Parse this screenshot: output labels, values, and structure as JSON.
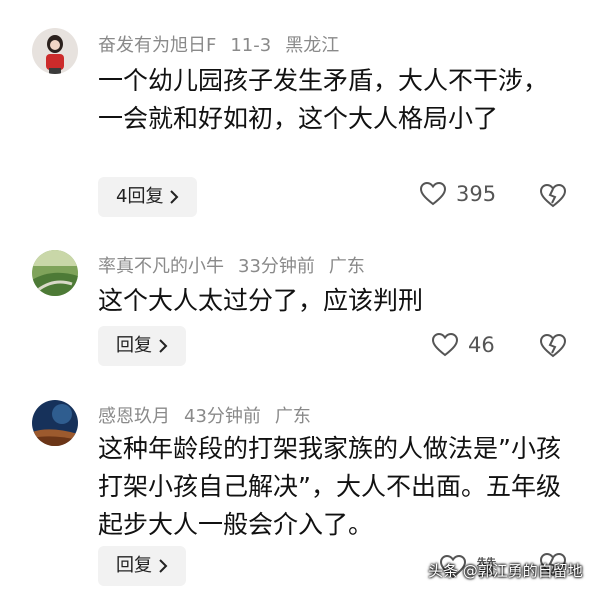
{
  "comments": [
    {
      "username": "奋发有为旭日F",
      "time": "11-3",
      "location": "黑龙江",
      "text": "一个幼儿园孩子发生矛盾，大人不干涉，一会就和好如初，这个大人格局小了",
      "reply_label": "4回复",
      "likes": "395"
    },
    {
      "username": "率真不凡的小牛",
      "time": "33分钟前",
      "location": "广东",
      "text": "这个大人太过分了，应该判刑",
      "reply_label": "回复",
      "likes": "46"
    },
    {
      "username": "感恩玖月",
      "time": "43分钟前",
      "location": "广东",
      "text": "这种年龄段的打架我家族的人做法是”小孩打架小孩自己解决”，大人不出面。五年级起步大人一般会介入了。",
      "reply_label": "回复",
      "likes": "赞"
    }
  ],
  "watermark": "头条 @郭江勇的自留地",
  "icons": {
    "chevron": "chevron-right-icon",
    "like": "heart-icon",
    "dislike": "broken-heart-icon"
  },
  "colors": {
    "meta": "#8a8a8a",
    "reply_bg": "#f2f2f2"
  }
}
